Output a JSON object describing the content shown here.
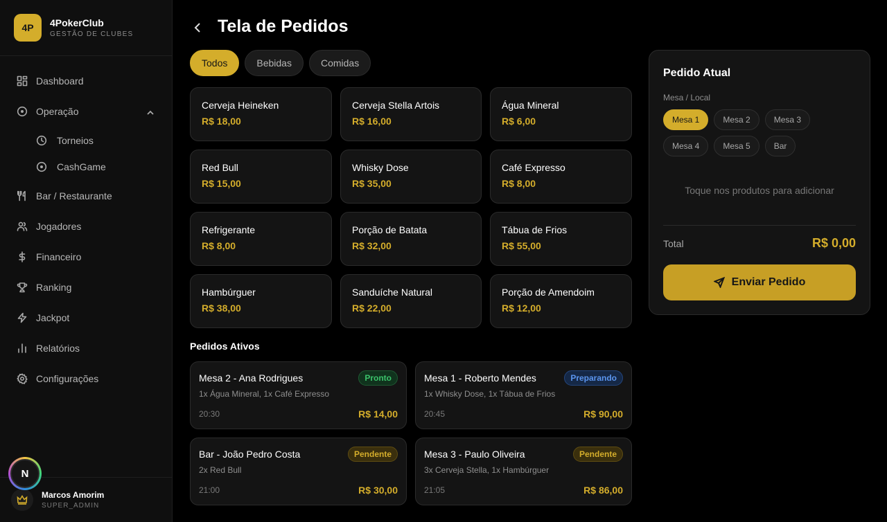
{
  "brand": {
    "logo": "4P",
    "name": "4PokerClub",
    "subtitle": "GESTÃO DE CLUBES"
  },
  "nav": {
    "dashboard": "Dashboard",
    "operacao": "Operação",
    "torneios": "Torneios",
    "cashgame": "CashGame",
    "bar": "Bar / Restaurante",
    "jogadores": "Jogadores",
    "financeiro": "Financeiro",
    "ranking": "Ranking",
    "jackpot": "Jackpot",
    "relatorios": "Relatórios",
    "configuracoes": "Configurações"
  },
  "user": {
    "name": "Marcos Amorim",
    "role": "SUPER_ADMIN",
    "badge": "N"
  },
  "header": {
    "title": "Tela de Pedidos"
  },
  "filters": [
    "Todos",
    "Bebidas",
    "Comidas"
  ],
  "products": [
    {
      "name": "Cerveja Heineken",
      "price": "R$ 18,00"
    },
    {
      "name": "Cerveja Stella Artois",
      "price": "R$ 16,00"
    },
    {
      "name": "Água Mineral",
      "price": "R$ 6,00"
    },
    {
      "name": "Red Bull",
      "price": "R$ 15,00"
    },
    {
      "name": "Whisky Dose",
      "price": "R$ 35,00"
    },
    {
      "name": "Café Expresso",
      "price": "R$ 8,00"
    },
    {
      "name": "Refrigerante",
      "price": "R$ 8,00"
    },
    {
      "name": "Porção de Batata",
      "price": "R$ 32,00"
    },
    {
      "name": "Tábua de Frios",
      "price": "R$ 55,00"
    },
    {
      "name": "Hambúrguer",
      "price": "R$ 38,00"
    },
    {
      "name": "Sanduíche Natural",
      "price": "R$ 22,00"
    },
    {
      "name": "Porção de Amendoim",
      "price": "R$ 12,00"
    }
  ],
  "orders_title": "Pedidos Ativos",
  "orders": [
    {
      "title": "Mesa 2 - Ana Rodrigues",
      "status": "Pronto",
      "items": "1x Água Mineral, 1x Café Expresso",
      "time": "20:30",
      "total": "R$ 14,00"
    },
    {
      "title": "Mesa 1 - Roberto Mendes",
      "status": "Preparando",
      "items": "1x Whisky Dose, 1x Tábua de Frios",
      "time": "20:45",
      "total": "R$ 90,00"
    },
    {
      "title": "Bar - João Pedro Costa",
      "status": "Pendente",
      "items": "2x Red Bull",
      "time": "21:00",
      "total": "R$ 30,00"
    },
    {
      "title": "Mesa 3 - Paulo Oliveira",
      "status": "Pendente",
      "items": "3x Cerveja Stella, 1x Hambúrguer",
      "time": "21:05",
      "total": "R$ 86,00"
    }
  ],
  "panel": {
    "title": "Pedido Atual",
    "location_label": "Mesa / Local",
    "tables": [
      "Mesa 1",
      "Mesa 2",
      "Mesa 3",
      "Mesa 4",
      "Mesa 5",
      "Bar"
    ],
    "empty": "Toque nos produtos para adicionar",
    "total_label": "Total",
    "total_value": "R$ 0,00",
    "send_label": "Enviar Pedido"
  },
  "colors": {
    "accent": "#d4ad2b",
    "ready": "#3bc26a",
    "preparing": "#5b95ee",
    "background": "#000000"
  }
}
